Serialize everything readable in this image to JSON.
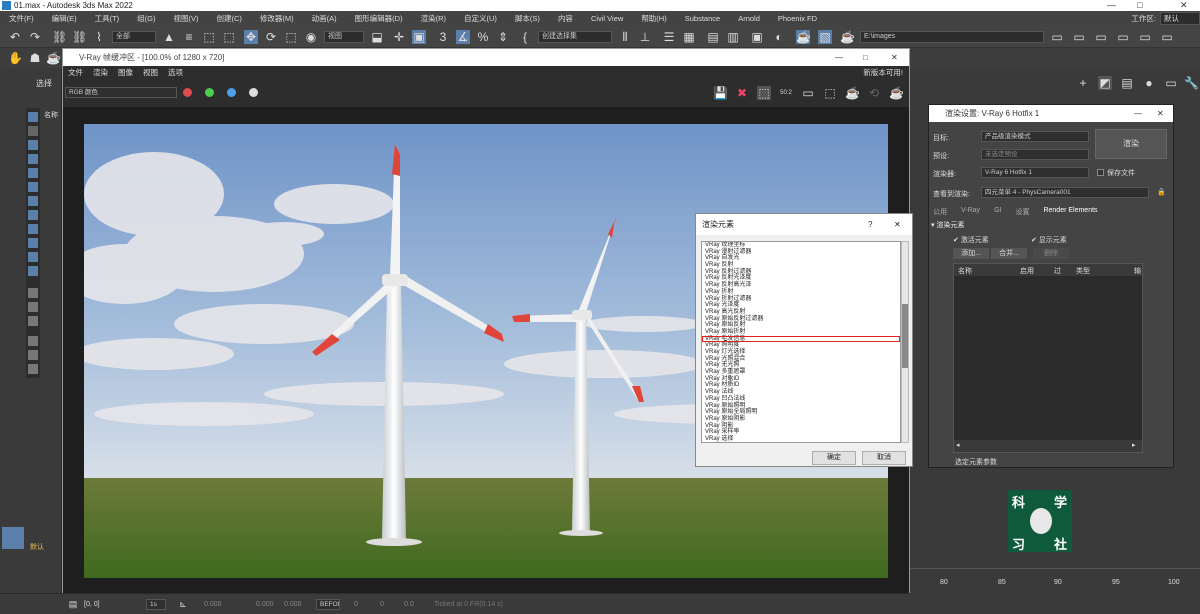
{
  "window": {
    "title": "01.max - Autodesk 3ds Max 2022",
    "controls": [
      "—",
      "□",
      "✕"
    ]
  },
  "menubar": [
    "文件(F)",
    "编辑(E)",
    "工具(T)",
    "组(G)",
    "视图(V)",
    "创建(C)",
    "修改器(M)",
    "动画(A)",
    "图形编辑器(D)",
    "渲染(R)",
    "自定义(U)",
    "脚本(S)",
    "内容",
    "Civil View",
    "帮助(H)",
    "Substance",
    "Arnold",
    "Phoenix FD"
  ],
  "workspace": {
    "label": "工作区:",
    "value": "默认"
  },
  "toolbar": {
    "filter": "全部",
    "view": "视图",
    "selection_set": "创建选择集",
    "camera": "PhysCamera001",
    "cam_value": "E:\\images"
  },
  "left_panel": {
    "tab": "选择",
    "name_header": "名称",
    "default_label": "默认"
  },
  "vfb": {
    "title": "V-Ray 帧缓冲区 - [100.0% of 1280 x 720]",
    "menu": [
      "文件",
      "渲染",
      "图像",
      "视图",
      "选项"
    ],
    "update_notice": "新版本可用!",
    "channel": "RGB 颜色",
    "ratio": "50:2"
  },
  "render_dialog": {
    "title": "渲染设置: V-Ray 6 Hotfix 1",
    "target_label": "目标:",
    "target_value": "产品级渲染模式",
    "preset_label": "预设:",
    "preset_value": "未选定预设",
    "renderer_label": "渲染器:",
    "renderer_value": "V-Ray 6 Hotfix 1",
    "save_file": "保存文件",
    "render_button": "渲染",
    "view_label": "查看到渲染:",
    "view_value": "四元菜单 4 - PhysCamera001",
    "tabs": [
      "公用",
      "V-Ray",
      "GI",
      "设置",
      "Render Elements"
    ],
    "section": "渲染元素",
    "activate": "激活元素",
    "show": "显示元素",
    "add": "添加...",
    "merge": "合并...",
    "delete": "删除",
    "columns": [
      "名称",
      "启用",
      "过",
      "类型",
      "输"
    ],
    "footer": "选定元素参数"
  },
  "elements_dialog": {
    "title": "渲染元素",
    "help": "?",
    "close": "✕",
    "items": [
      "VRay 纹理坐标",
      "VRay 漫射过滤器",
      "VRay 自发光",
      "VRay 反射",
      "VRay 反射过滤器",
      "VRay 反射光泽度",
      "VRay 反射高光泽",
      "VRay 折射",
      "VRay 折射过滤器",
      "VRay 光泽度",
      "VRay 高光反射",
      "VRay 原始反射过滤器",
      "VRay 原始反射",
      "VRay 原始折射",
      "VRay 毛发信息",
      "VRay 照明度",
      "VRay 灯光选择",
      "VRay 光照混合",
      "VRay 无光照",
      "VRay 多重遮罩",
      "VRay 对象ID",
      "VRay 材质ID",
      "VRay 法线",
      "VRay 凹凸法线",
      "VRay 原始照明",
      "VRay 原始全局照明",
      "VRay 原始阴影",
      "VRay 阴影",
      "VRay 采样率",
      "VRay 选择",
      "VRay 速度",
      "VRay Z深度",
      "VRay 降噪器",
      "VRay 去噪器输出",
      "VRay 降噪器反射",
      "VRay 降噪器折射",
      "VRay 降噪器漫射",
      "VRay 降噪器全局照明",
      "VRay 降噪器背景",
      "VRay 降噪器阴影",
      "VRay 降噪器曲率",
      "VRay 降噪器遮罩",
      "VRay 降噪器高光"
    ],
    "highlighted_index": 14,
    "ok": "确定",
    "cancel": "取消"
  },
  "status": {
    "coords": "[0, 0]",
    "x": "0.000",
    "y": "0.000",
    "z": "0.000",
    "frame1": "0",
    "frame2": "0",
    "frame3": "0.0",
    "grid_value": "BEFORE",
    "status_text": "Ticked at 0 FR(0.14 s)"
  },
  "timeline": {
    "ticks": [
      "80",
      "85",
      "90",
      "95",
      "100"
    ]
  },
  "logo": {
    "chars": [
      "科",
      "学",
      "习",
      "社"
    ]
  }
}
